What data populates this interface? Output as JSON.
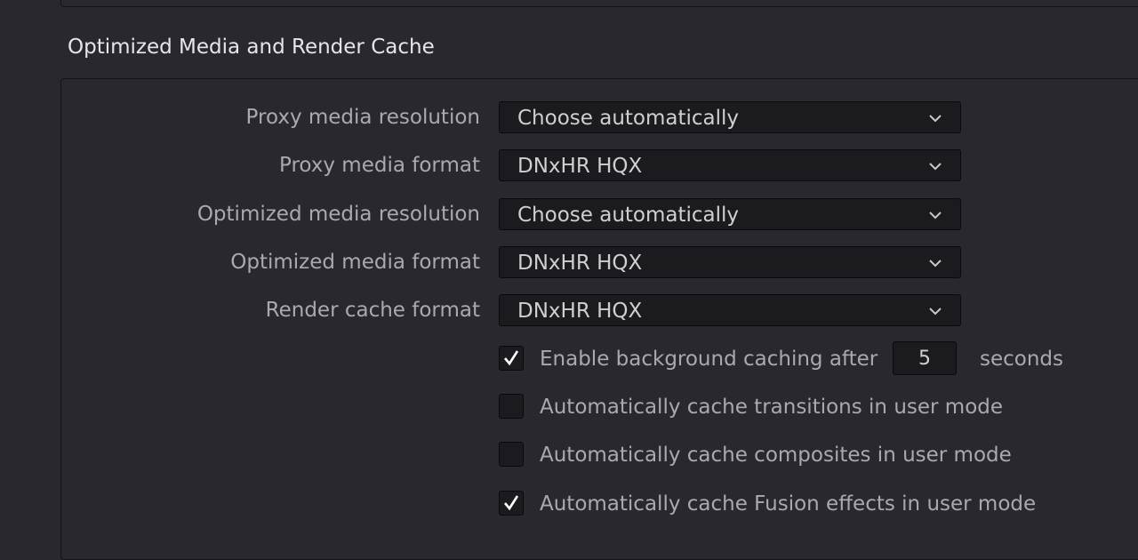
{
  "section": {
    "title": "Optimized Media and Render Cache"
  },
  "rows": [
    {
      "label": "Proxy media resolution",
      "value": "Choose automatically"
    },
    {
      "label": "Proxy media format",
      "value": "DNxHR HQX"
    },
    {
      "label": "Optimized media resolution",
      "value": "Choose automatically"
    },
    {
      "label": "Optimized media format",
      "value": "DNxHR HQX"
    },
    {
      "label": "Render cache format",
      "value": "DNxHR HQX"
    }
  ],
  "checks": [
    {
      "label": "Enable background caching after",
      "checked": true
    },
    {
      "label": "Automatically cache transitions in user mode",
      "checked": false
    },
    {
      "label": "Automatically cache composites in user mode",
      "checked": false
    },
    {
      "label": "Automatically cache Fusion effects in user mode",
      "checked": true
    }
  ],
  "background_caching": {
    "seconds_value": "5",
    "suffix": "seconds"
  },
  "icons": {
    "dropdown": "chevron-down-icon",
    "check": "checkmark-icon"
  }
}
